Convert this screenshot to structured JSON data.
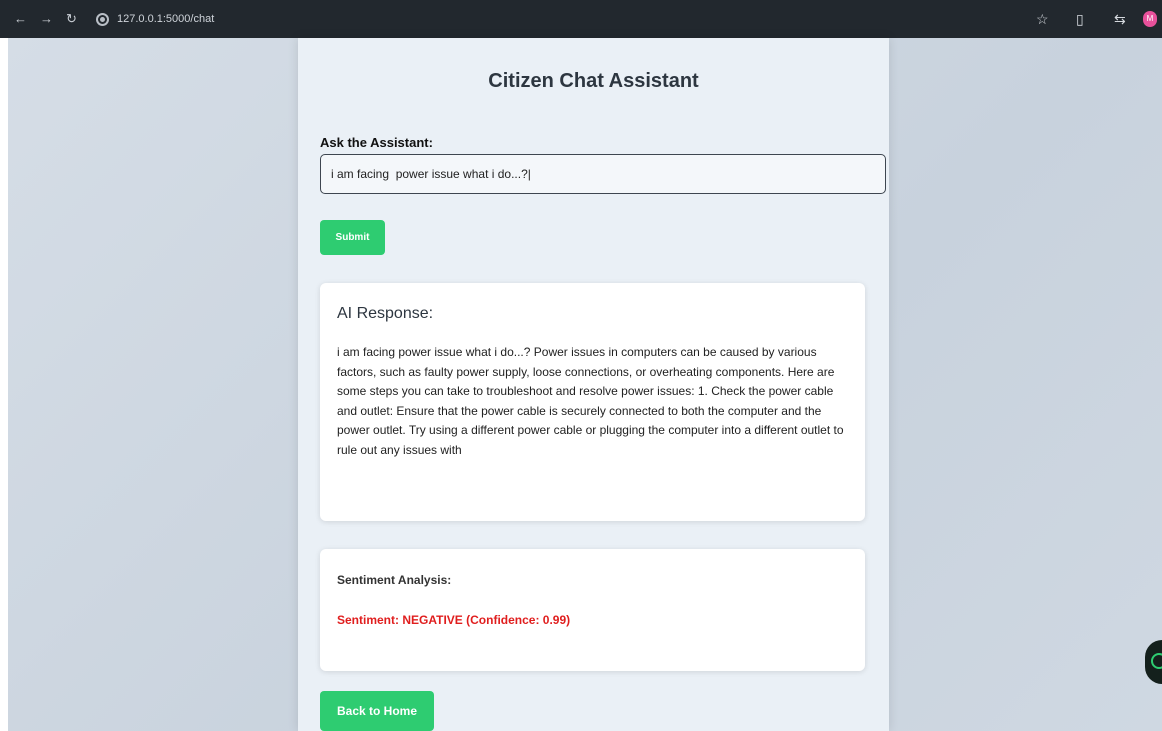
{
  "browser": {
    "url": "127.0.0.1:5000/chat",
    "back_glyph": "←",
    "forward_glyph": "→",
    "reload_glyph": "↻",
    "star_glyph": "☆",
    "sidepanel_glyph": "▯",
    "extension_glyph": "⇆",
    "profile_initial": "M"
  },
  "page": {
    "title": "Citizen Chat Assistant",
    "ask_label": "Ask the Assistant:",
    "query_value": "i am facing  power issue what i do...?|",
    "submit_label": "Submit",
    "response_heading": "AI Response:",
    "response_text": "i am facing power issue what i do...? Power issues in computers can be caused by various factors, such as faulty power supply, loose connections, or overheating components. Here are some steps you can take to troubleshoot and resolve power issues: 1. Check the power cable and outlet: Ensure that the power cable is securely connected to both the computer and the power outlet. Try using a different power cable or plugging the computer into a different outlet to rule out any issues with",
    "sentiment_heading": "Sentiment Analysis:",
    "sentiment_result": "Sentiment: NEGATIVE (Confidence: 0.99)",
    "back_home_label": "Back to Home"
  },
  "colors": {
    "accent_green": "#2ecc71",
    "negative_red": "#e01e1e",
    "chrome_dark": "#22282e"
  }
}
